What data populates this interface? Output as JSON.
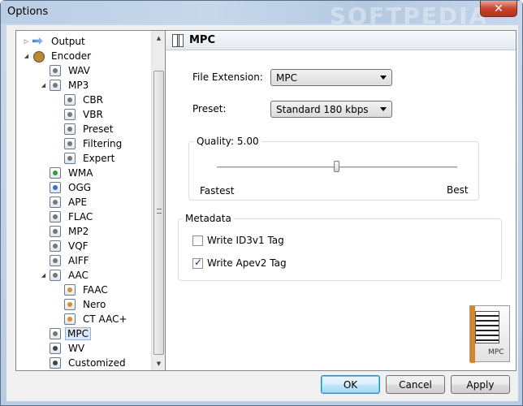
{
  "window": {
    "title": "Options",
    "watermark": "SOFTPEDIA",
    "close_glyph": "✕"
  },
  "tree": [
    {
      "label": "Output",
      "indent": 0,
      "expander": "▷",
      "icon": "arrow-icon"
    },
    {
      "label": "Encoder",
      "indent": 0,
      "expander": "◢",
      "icon": "gear-icon"
    },
    {
      "label": "WAV",
      "indent": 1,
      "expander": "",
      "icon": "wav-icon"
    },
    {
      "label": "MP3",
      "indent": 1,
      "expander": "◢",
      "icon": "mp3-icon"
    },
    {
      "label": "CBR",
      "indent": 2,
      "expander": "",
      "icon": "settings-icon"
    },
    {
      "label": "VBR",
      "indent": 2,
      "expander": "",
      "icon": "settings-icon"
    },
    {
      "label": "Preset",
      "indent": 2,
      "expander": "",
      "icon": "settings-icon"
    },
    {
      "label": "Filtering",
      "indent": 2,
      "expander": "",
      "icon": "settings-icon"
    },
    {
      "label": "Expert",
      "indent": 2,
      "expander": "",
      "icon": "settings-icon"
    },
    {
      "label": "WMA",
      "indent": 1,
      "expander": "",
      "icon": "wma-icon"
    },
    {
      "label": "OGG",
      "indent": 1,
      "expander": "",
      "icon": "ogg-icon"
    },
    {
      "label": "APE",
      "indent": 1,
      "expander": "",
      "icon": "ape-icon"
    },
    {
      "label": "FLAC",
      "indent": 1,
      "expander": "",
      "icon": "flac-icon"
    },
    {
      "label": "MP2",
      "indent": 1,
      "expander": "",
      "icon": "mp2-icon"
    },
    {
      "label": "VQF",
      "indent": 1,
      "expander": "",
      "icon": "vqf-icon"
    },
    {
      "label": "AIFF",
      "indent": 1,
      "expander": "",
      "icon": "aiff-icon"
    },
    {
      "label": "AAC",
      "indent": 1,
      "expander": "◢",
      "icon": "aac-icon"
    },
    {
      "label": "FAAC",
      "indent": 2,
      "expander": "",
      "icon": "faac-icon"
    },
    {
      "label": "Nero",
      "indent": 2,
      "expander": "",
      "icon": "nero-icon"
    },
    {
      "label": "CT AAC+",
      "indent": 2,
      "expander": "",
      "icon": "ctaac-icon"
    },
    {
      "label": "MPC",
      "indent": 1,
      "expander": "",
      "icon": "mpc-icon",
      "selected": true
    },
    {
      "label": "WV",
      "indent": 1,
      "expander": "",
      "icon": "wv-icon"
    },
    {
      "label": "Customized",
      "indent": 1,
      "expander": "",
      "icon": "customized-icon"
    }
  ],
  "panel": {
    "title": "MPC",
    "file_extension": {
      "label": "File Extension:",
      "value": "MPC"
    },
    "preset": {
      "label": "Preset:",
      "value": "Standard   180 kbps"
    },
    "quality": {
      "label": "Quality: 5.00",
      "value": 5.0,
      "min_label": "Fastest",
      "max_label": "Best"
    },
    "metadata": {
      "title": "Metadata",
      "id3v1": {
        "label": "Write ID3v1 Tag",
        "checked": false
      },
      "apev2": {
        "label": "Write Apev2 Tag",
        "checked": true
      }
    },
    "icon_caption": "MPC"
  },
  "buttons": {
    "ok": "OK",
    "cancel": "Cancel",
    "apply": "Apply"
  }
}
